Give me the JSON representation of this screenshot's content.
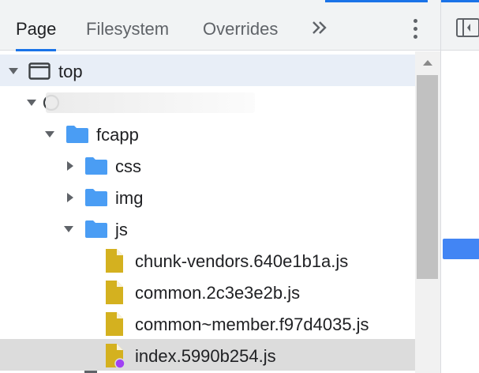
{
  "tabs": {
    "page": "Page",
    "filesystem": "Filesystem",
    "overrides": "Overrides"
  },
  "icons": {
    "more_tabs": "double-chevron-right-icon",
    "menu": "kebab-menu-icon",
    "dock": "dock-side-icon"
  },
  "colors": {
    "accent": "#1a73e8",
    "folder": "#4a9df4",
    "file": "#d4b11f",
    "badge": "#a142f4"
  },
  "tree": {
    "top": "top",
    "origin": "",
    "fcapp": "fcapp",
    "css": "css",
    "img": "img",
    "js": "js",
    "files": [
      "chunk-vendors.640e1b1a.js",
      "common.2c3e3e2b.js",
      "common~member.f97d4035.js",
      "index.5990b254.js"
    ]
  }
}
